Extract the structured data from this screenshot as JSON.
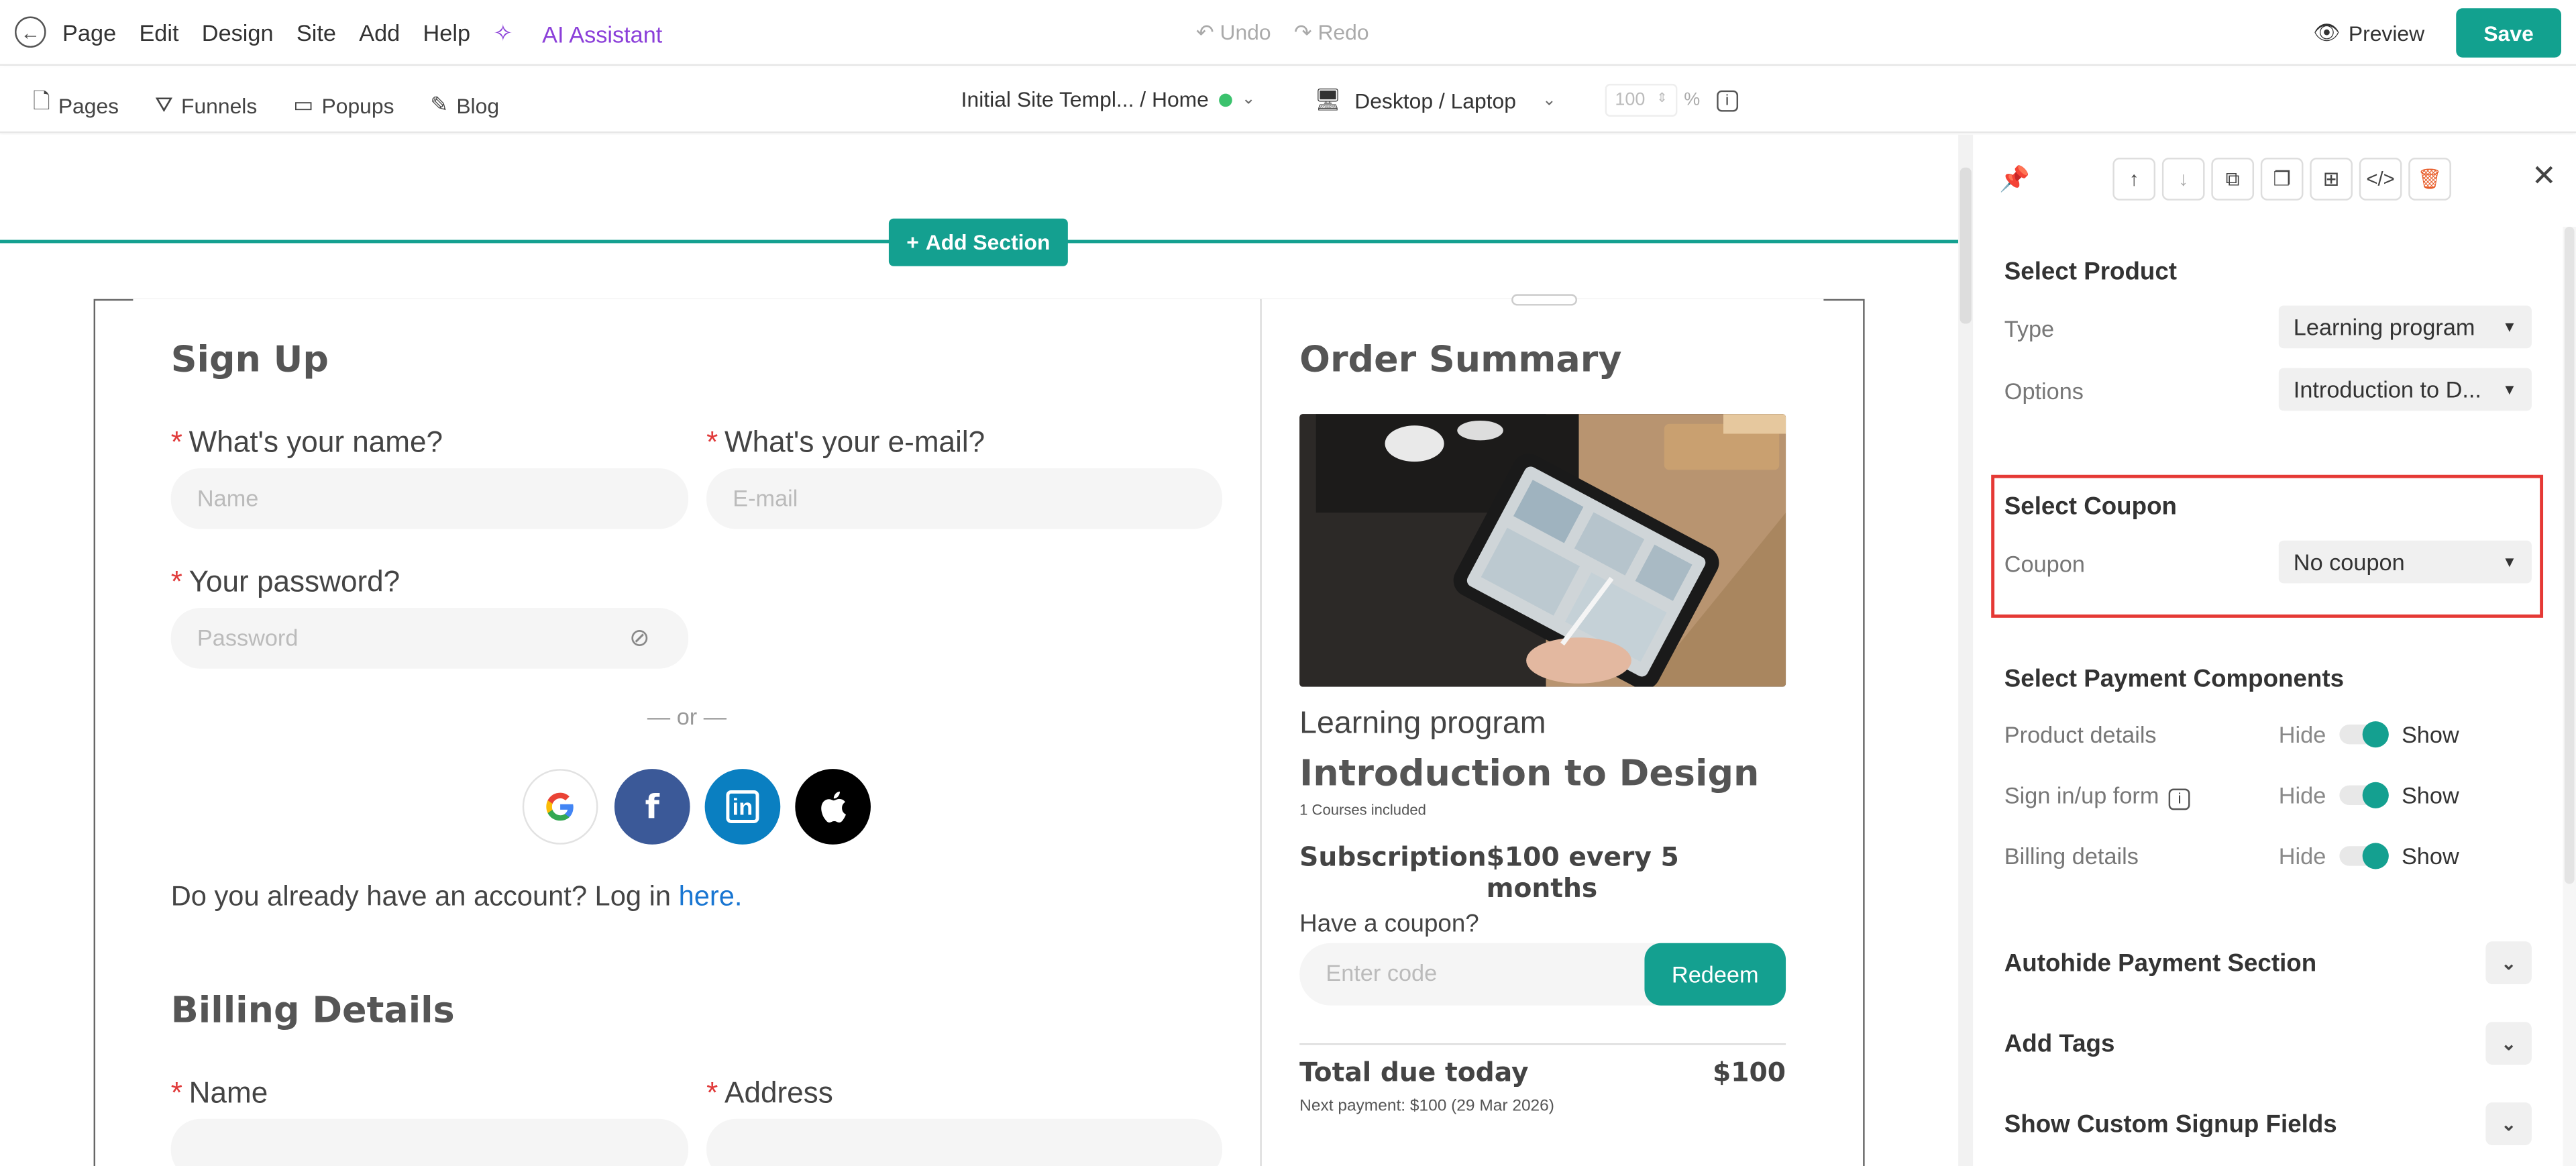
{
  "topbar": {
    "menu": [
      "Page",
      "Edit",
      "Design",
      "Site",
      "Add",
      "Help"
    ],
    "ai_assistant": "AI Assistant",
    "undo": "Undo",
    "redo": "Redo",
    "preview": "Preview",
    "save": "Save"
  },
  "subbar": {
    "nav": [
      "Pages",
      "Funnels",
      "Popups",
      "Blog"
    ],
    "breadcrumb": "Initial Site Templ... / Home",
    "device": "Desktop / Laptop",
    "zoom_value": "100",
    "zoom_unit": "%"
  },
  "canvas": {
    "add_section": "Add Section",
    "signup_title": "Sign Up",
    "name_label": "What's your name?",
    "name_placeholder": "Name",
    "email_label": "What's your e-mail?",
    "email_placeholder": "E-mail",
    "password_label": "Your password?",
    "password_placeholder": "Password",
    "or_text": "— or —",
    "login_text": "Do you already have an account? Log in",
    "login_link": "here.",
    "billing_title": "Billing Details",
    "billing_name_label": "Name",
    "billing_address_label": "Address",
    "required_mark": "*"
  },
  "order": {
    "title": "Order Summary",
    "program_type": "Learning program",
    "course_name": "Introduction to Design",
    "courses_included": "1 Courses included",
    "subscription_label": "Subscription",
    "subscription_price": "$100 every 5 months",
    "coupon_question": "Have a coupon?",
    "coupon_placeholder": "Enter code",
    "redeem": "Redeem",
    "total_label": "Total due today",
    "total_value": "$100",
    "next_payment": "Next payment: $100 (29 Mar 2026)"
  },
  "sidebar": {
    "select_product": "Select Product",
    "type_label": "Type",
    "type_value": "Learning program",
    "options_label": "Options",
    "options_value": "Introduction to D...",
    "select_coupon": "Select Coupon",
    "coupon_label": "Coupon",
    "coupon_value": "No coupon",
    "payment_components": "Select Payment Components",
    "rows": [
      {
        "label": "Product details",
        "hide": "Hide",
        "show": "Show"
      },
      {
        "label": "Sign in/up form",
        "hide": "Hide",
        "show": "Show"
      },
      {
        "label": "Billing details",
        "hide": "Hide",
        "show": "Show"
      }
    ],
    "accordions": [
      "Autohide Payment Section",
      "Add Tags",
      "Show Custom Signup Fields"
    ]
  },
  "colors": {
    "accent": "#14a090",
    "ai": "#8b3fd9",
    "highlight": "#e53935",
    "facebook": "#3b5998",
    "linkedin": "#0a7fc1"
  }
}
